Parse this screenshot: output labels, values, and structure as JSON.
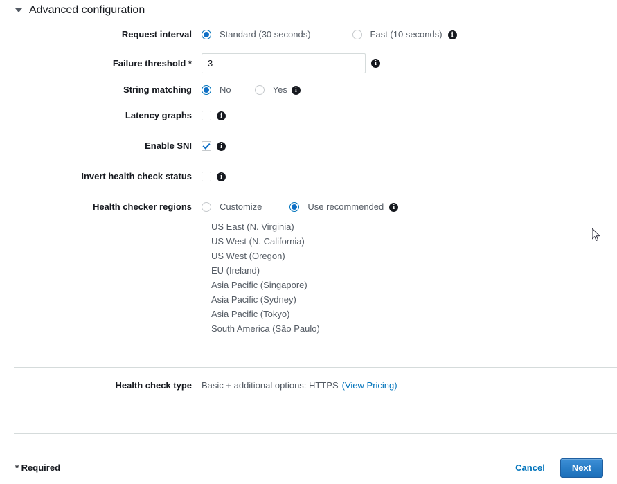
{
  "section": {
    "title": "Advanced configuration",
    "expanded": true,
    "caret_icon": "chevron-down-icon"
  },
  "fields": {
    "request_interval": {
      "label": "Request interval",
      "options": [
        {
          "label": "Standard (30 seconds)",
          "selected": true
        },
        {
          "label": "Fast (10 seconds)",
          "selected": false
        }
      ],
      "info_icon": "info-icon"
    },
    "failure_threshold": {
      "label": "Failure threshold *",
      "value": "3",
      "info_icon": "info-icon"
    },
    "string_matching": {
      "label": "String matching",
      "options": [
        {
          "label": "No",
          "selected": true
        },
        {
          "label": "Yes",
          "selected": false
        }
      ],
      "info_icon": "info-icon"
    },
    "latency_graphs": {
      "label": "Latency graphs",
      "checked": false,
      "info_icon": "info-icon"
    },
    "enable_sni": {
      "label": "Enable SNI",
      "checked": true,
      "info_icon": "info-icon"
    },
    "invert_health_check_status": {
      "label": "Invert health check status",
      "checked": false,
      "info_icon": "info-icon"
    },
    "health_checker_regions": {
      "label": "Health checker regions",
      "options": [
        {
          "label": "Customize",
          "selected": false
        },
        {
          "label": "Use recommended",
          "selected": true
        }
      ],
      "info_icon": "info-icon",
      "regions": [
        "US East (N. Virginia)",
        "US West (N. California)",
        "US West (Oregon)",
        "EU (Ireland)",
        "Asia Pacific (Singapore)",
        "Asia Pacific (Sydney)",
        "Asia Pacific (Tokyo)",
        "South America (São Paulo)"
      ]
    },
    "health_check_type": {
      "label": "Health check type",
      "value": "Basic + additional options: HTTPS",
      "link_text": "(View Pricing)"
    }
  },
  "footer": {
    "required_note": "* Required",
    "cancel_label": "Cancel",
    "next_label": "Next"
  },
  "colors": {
    "accent_blue": "#0073bb",
    "radio_fill": "#0f6fc5",
    "button_blue": "#2a7ec7",
    "divider": "#d5dbdb",
    "label_text": "#16191f",
    "value_text": "#545b64"
  }
}
